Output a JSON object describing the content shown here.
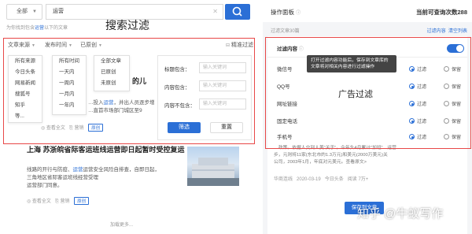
{
  "search": {
    "scope": "全部",
    "query": "运营",
    "tip_prefix": "为你找到包含",
    "tip_keyword": "运营",
    "tip_suffix": "以下的文章"
  },
  "left_title": "搜索过滤",
  "filterbar": {
    "source": "文章来源",
    "time": "发布时间",
    "original": "已原创",
    "advanced": "精准过滤"
  },
  "dropdowns": {
    "sources": [
      "所有来源",
      "今日头条",
      "网易新闻",
      "搜狐号",
      "知乎",
      "等..."
    ],
    "times": [
      "所有时间",
      "一天内",
      "一周内",
      "一月内",
      "一年内"
    ],
    "original": [
      "全部文章",
      "已原创",
      "未原创"
    ]
  },
  "filter_form": {
    "title_label": "标题包含：",
    "content_label": "内容包含：",
    "exclude_label": "内容不包含：",
    "placeholder": "输入关键词",
    "filter_button": "筛选",
    "reset_button": "重置"
  },
  "articles": [
    {
      "title_fragment": "文、的儿",
      "body_1": "…投入",
      "body_keyword": "运营",
      "body_2": "，并出人员逐步增",
      "body_3": "…直首市场部门城区至9",
      "view_all": "查看全文",
      "share": "营销",
      "tag": "原创"
    },
    {
      "title": "上海 苏浙皖省际客运班线运营即日起暂时受控复运",
      "body_lines": [
        "线路的开行与防疫、",
        "运营安全风险自排查，自即日起，",
        "三角地区省际客运班线经营受理",
        "运营部门同意。"
      ],
      "body_keyword": "运营",
      "view_all": "查看全文",
      "share": "营销",
      "tag": "原创"
    }
  ],
  "load_more": "加载更多...",
  "right_panel": {
    "title": "操作面板",
    "remaining_label": "当前可查询次数",
    "remaining_count": "288",
    "found_text": "过滤文章30篇",
    "links": [
      "过滤内容",
      "清空列表"
    ],
    "filter_card_title": "过滤内容",
    "tooltip": "打开过滤内容功能后，保存到文章库的文章将对相关内容进行过滤操作",
    "ad_label": "广告过滤",
    "rows": [
      {
        "name": "微信号",
        "opt1": "过滤",
        "opt2": "保留"
      },
      {
        "name": "QQ号",
        "opt1": "过滤",
        "opt2": "保留"
      },
      {
        "name": "网址链接",
        "opt1": "过滤",
        "opt2": "保留"
      },
      {
        "name": "固定电话",
        "opt1": "过滤",
        "opt2": "保留"
      },
      {
        "name": "手机号",
        "opt1": "过滤",
        "opt2": "保留"
      }
    ],
    "bottom_text_1": "…政策。依据人交到人美“关于”，今年头4月累计“加班”…运营",
    "bottom_text_2": "步，元则将11家(东北市的1.3万元)和美元(2000万美元)关",
    "bottom_text_3": "公司，2003年1月，年底对元美元。查看原文>",
    "bottom_meta_source": "华商连线",
    "bottom_meta_date": "2020-03-19",
    "bottom_meta_platform": "今日头条",
    "bottom_meta_read": "阅读 7万+",
    "save_button": "保存到文章"
  },
  "watermark": "知乎 @牛蚁写作",
  "colors": {
    "accent": "#2b6fd6",
    "highlight_box": "#e84848"
  }
}
